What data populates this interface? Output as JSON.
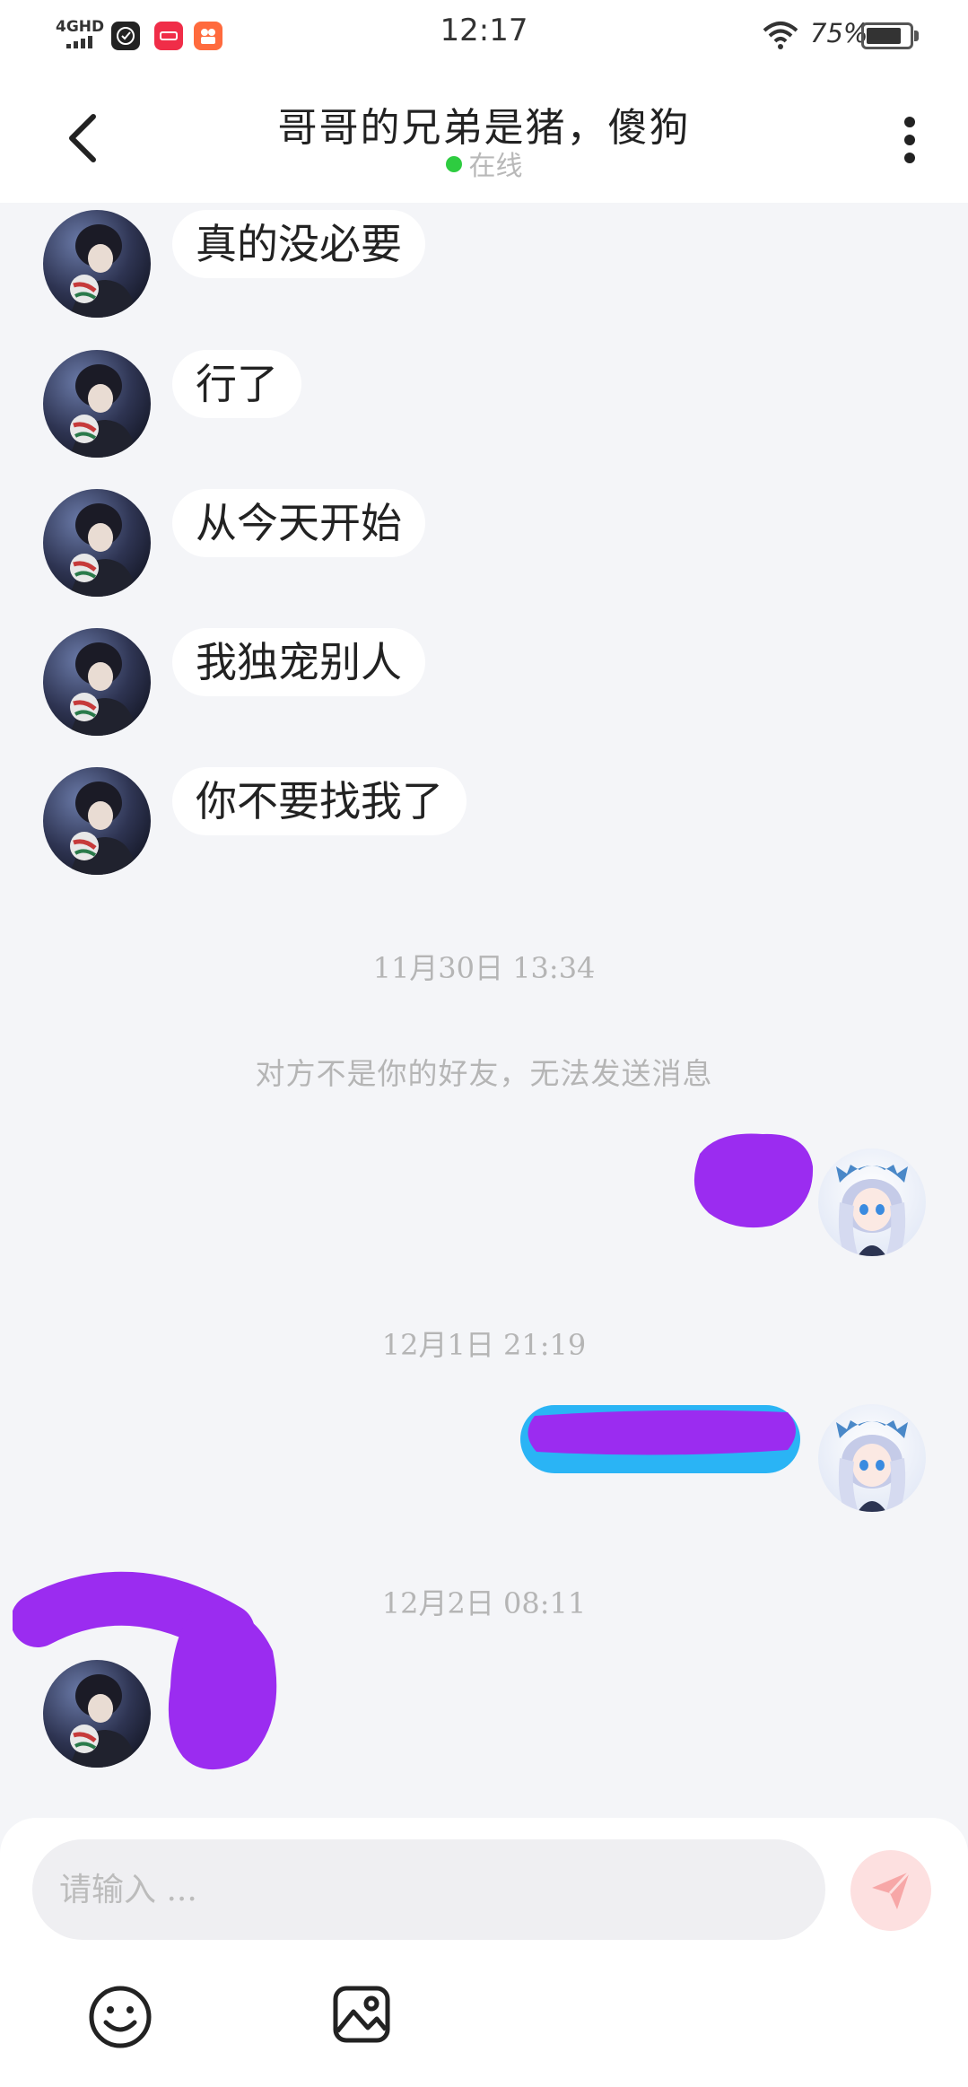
{
  "status_bar": {
    "network": "4GHD",
    "time": "12:17",
    "battery_percent": "75%",
    "app_icons": [
      "clock-app-icon",
      "red-app-icon",
      "video-app-icon"
    ]
  },
  "header": {
    "title": "哥哥的兄弟是猪，傻狗",
    "status": "在线",
    "status_color": "#2ecc40"
  },
  "messages": [
    {
      "from": "other",
      "text": "真的没必要"
    },
    {
      "from": "other",
      "text": "行了"
    },
    {
      "from": "other",
      "text": "从今天开始"
    },
    {
      "from": "other",
      "text": "我独宠别人"
    },
    {
      "from": "other",
      "text": "你不要找我了"
    }
  ],
  "timestamps": [
    "11月30日 13:34",
    "12月1日 21:19",
    "12月2日 08:11"
  ],
  "system_message": "对方不是你的好友，无法发送消息",
  "redactions": {
    "color": "#9b2cf0",
    "bubble_color": "#2ab4f5"
  },
  "input": {
    "placeholder": "请输入 ...",
    "value": ""
  },
  "colors": {
    "background": "#f4f5f8",
    "bubble": "#ffffff",
    "send_button": "#fde0e0",
    "send_icon": "#f7a7a7"
  }
}
